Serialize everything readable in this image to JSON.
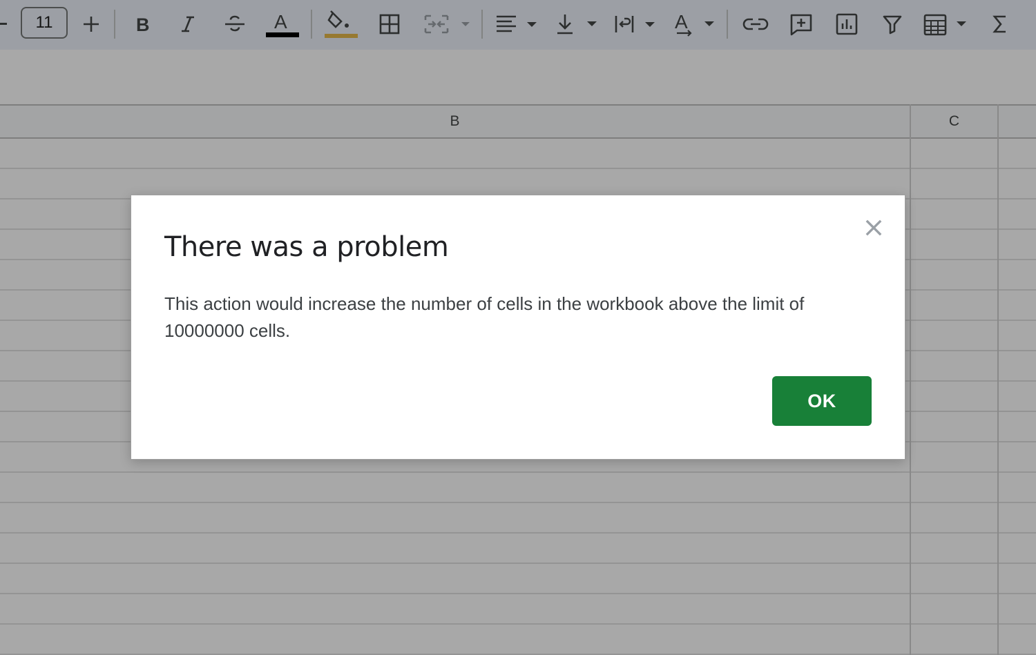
{
  "toolbar": {
    "font_size": "11",
    "text_color": "#000000",
    "fill_color": "#e6b84a",
    "icons": [
      "minus-icon",
      "plus-icon",
      "bold-icon",
      "italic-icon",
      "strikethrough-icon",
      "text-color-icon",
      "fill-color-icon",
      "borders-icon",
      "merge-cells-icon",
      "horizontal-align-icon",
      "vertical-align-icon",
      "text-wrapping-icon",
      "text-rotation-icon",
      "insert-link-icon",
      "insert-comment-icon",
      "insert-chart-icon",
      "filter-icon",
      "filter-views-icon",
      "functions-icon"
    ]
  },
  "sheet": {
    "columns": [
      {
        "label": "B"
      },
      {
        "label": "C"
      }
    ]
  },
  "dialog": {
    "title": "There was a problem",
    "message": "This action would increase the number of cells in the workbook above the limit of 10000000 cells.",
    "ok_label": "OK",
    "close_icon": "close-icon",
    "accent_color": "#188038"
  }
}
